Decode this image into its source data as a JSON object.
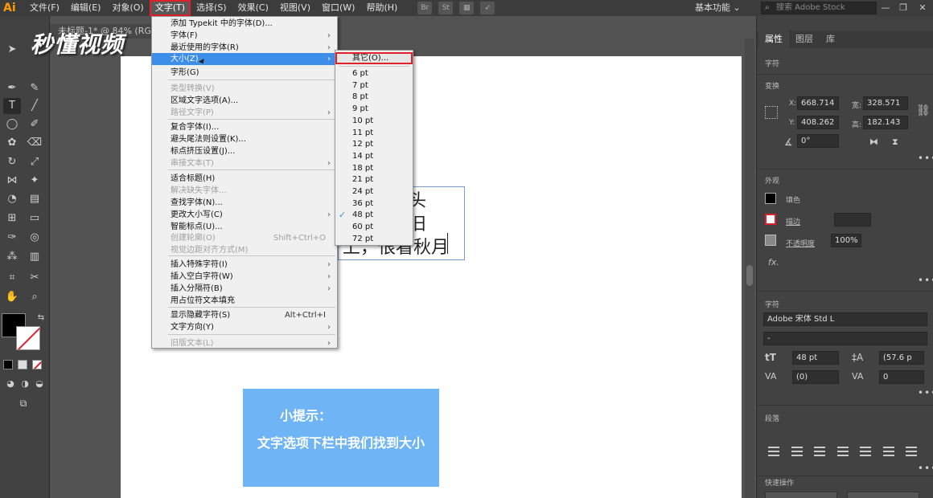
{
  "app": {
    "logo": "Ai"
  },
  "menubar": {
    "items": [
      "文件(F)",
      "编辑(E)",
      "对象(O)",
      "文字(T)",
      "选择(S)",
      "效果(C)",
      "视图(V)",
      "窗口(W)",
      "帮助(H)"
    ],
    "active_index": 3,
    "icons": [
      "Br",
      "St"
    ],
    "workspace": "基本功能",
    "search_placeholder": "搜索 Adobe Stock"
  },
  "document": {
    "tab_title": "未标题-1* @ 84% (RG"
  },
  "watermark": "秒懂视频",
  "poem_lines": [
    "转头",
    "依旧",
    "', 恨看秋月|"
  ],
  "poem_visible": [
    "转头",
    "依旧",
    "上，恨看秋月"
  ],
  "tip": {
    "title": "小提示：",
    "body": "文字选项下栏中我们找到大小"
  },
  "type_menu": {
    "items": [
      {
        "label": "添加 Typekit 中的字体(D)...",
        "enabled": true,
        "submenu": false
      },
      {
        "label": "字体(F)",
        "enabled": true,
        "submenu": true
      },
      {
        "label": "最近使用的字体(R)",
        "enabled": true,
        "submenu": true
      },
      {
        "label": "大小(Z)",
        "enabled": true,
        "submenu": true,
        "highlighted": true
      },
      {
        "label": "字形(G)",
        "enabled": true,
        "submenu": false
      },
      {
        "label": "类型转换(V)",
        "enabled": false,
        "submenu": false
      },
      {
        "label": "区域文字选项(A)...",
        "enabled": true,
        "submenu": false
      },
      {
        "label": "路径文字(P)",
        "enabled": false,
        "submenu": true
      },
      {
        "label": "复合字体(I)...",
        "enabled": true,
        "submenu": false
      },
      {
        "label": "避头尾法则设置(K)...",
        "enabled": true,
        "submenu": false
      },
      {
        "label": "标点挤压设置(J)...",
        "enabled": true,
        "submenu": false
      },
      {
        "label": "串接文本(T)",
        "enabled": false,
        "submenu": true
      },
      {
        "label": "适合标题(H)",
        "enabled": true,
        "submenu": false
      },
      {
        "label": "解决缺失字体...",
        "enabled": false,
        "submenu": false
      },
      {
        "label": "查找字体(N)...",
        "enabled": true,
        "submenu": false
      },
      {
        "label": "更改大小写(C)",
        "enabled": true,
        "submenu": true
      },
      {
        "label": "智能标点(U)...",
        "enabled": true,
        "submenu": false
      },
      {
        "label": "创建轮廓(O)",
        "enabled": false,
        "submenu": false,
        "shortcut": "Shift+Ctrl+O"
      },
      {
        "label": "视觉边距对齐方式(M)",
        "enabled": false,
        "submenu": false
      },
      {
        "label": "插入特殊字符(I)",
        "enabled": true,
        "submenu": true
      },
      {
        "label": "插入空白字符(W)",
        "enabled": true,
        "submenu": true
      },
      {
        "label": "插入分隔符(B)",
        "enabled": true,
        "submenu": true
      },
      {
        "label": "用占位符文本填充",
        "enabled": true,
        "submenu": false
      },
      {
        "label": "显示隐藏字符(S)",
        "enabled": true,
        "submenu": false,
        "shortcut": "Alt+Ctrl+I"
      },
      {
        "label": "文字方向(Y)",
        "enabled": true,
        "submenu": true
      },
      {
        "label": "旧版文本(L)",
        "enabled": false,
        "submenu": true
      }
    ]
  },
  "size_submenu": {
    "other": "其它(O)...",
    "sizes": [
      "6 pt",
      "7 pt",
      "8 pt",
      "9 pt",
      "10 pt",
      "11 pt",
      "12 pt",
      "14 pt",
      "18 pt",
      "21 pt",
      "24 pt",
      "36 pt",
      "48 pt",
      "60 pt",
      "72 pt"
    ],
    "checked": "48 pt"
  },
  "panel": {
    "tabs": [
      "属性",
      "图层",
      "库"
    ],
    "section_type": "字符",
    "transform_label": "变换",
    "x_label": "X:",
    "x": "668.714",
    "y_label": "Y:",
    "y": "408.262",
    "w_label": "宽:",
    "w": "328.571",
    "h_label": "高:",
    "h": "182.143",
    "angle": "0°",
    "appearance_label": "外观",
    "fill_label": "填色",
    "stroke_label": "描边",
    "opacity_label": "不透明度",
    "opacity": "100%",
    "fx": "fx.",
    "character_label": "字符",
    "font_family": "Adobe 宋体 Std L",
    "font_style": "-",
    "font_size": "48 pt",
    "leading": "(57.6 p",
    "kerning": "(0)",
    "tracking": "0",
    "paragraph_label": "段落",
    "quick_actions_label": "快速操作"
  },
  "colors": {
    "accent_red": "#e0202a",
    "menu_highlight": "#3d8ee8",
    "tip_bg": "#6fb5f5"
  }
}
